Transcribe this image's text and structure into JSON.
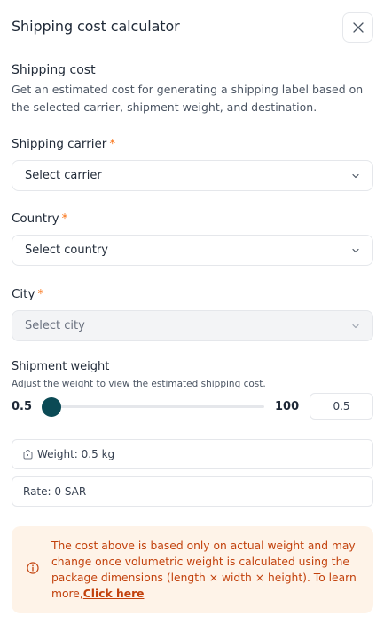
{
  "header": {
    "title": "Shipping cost calculator"
  },
  "shipping_cost": {
    "title": "Shipping cost",
    "description": "Get an estimated cost for generating a shipping label based on the selected carrier, shipment weight, and destination."
  },
  "carrier": {
    "label": "Shipping carrier",
    "required_mark": "*",
    "placeholder": "Select carrier"
  },
  "country": {
    "label": "Country",
    "required_mark": "*",
    "placeholder": "Select country"
  },
  "city": {
    "label": "City",
    "required_mark": "*",
    "placeholder": "Select city",
    "disabled": true
  },
  "weight": {
    "title": "Shipment weight",
    "hint": "Adjust the weight to view the estimated shipping cost.",
    "min_label": "0.5",
    "max_label": "100",
    "min": 0.5,
    "max": 100,
    "value": 0.5,
    "input_value": "0.5"
  },
  "summary": {
    "weight_text": "Weight: 0.5 kg",
    "rate_text": "Rate: 0 SAR"
  },
  "notice": {
    "text": "The cost above is based only on actual weight and may change once volumetric weight is calculated using the package dimensions (length × width × height). To learn more,",
    "link_text": "Click here"
  },
  "colors": {
    "accent_orange": "#f97316",
    "slider_thumb": "#0b4a55",
    "notice_bg": "#fef3e8",
    "notice_text": "#c2410c"
  }
}
